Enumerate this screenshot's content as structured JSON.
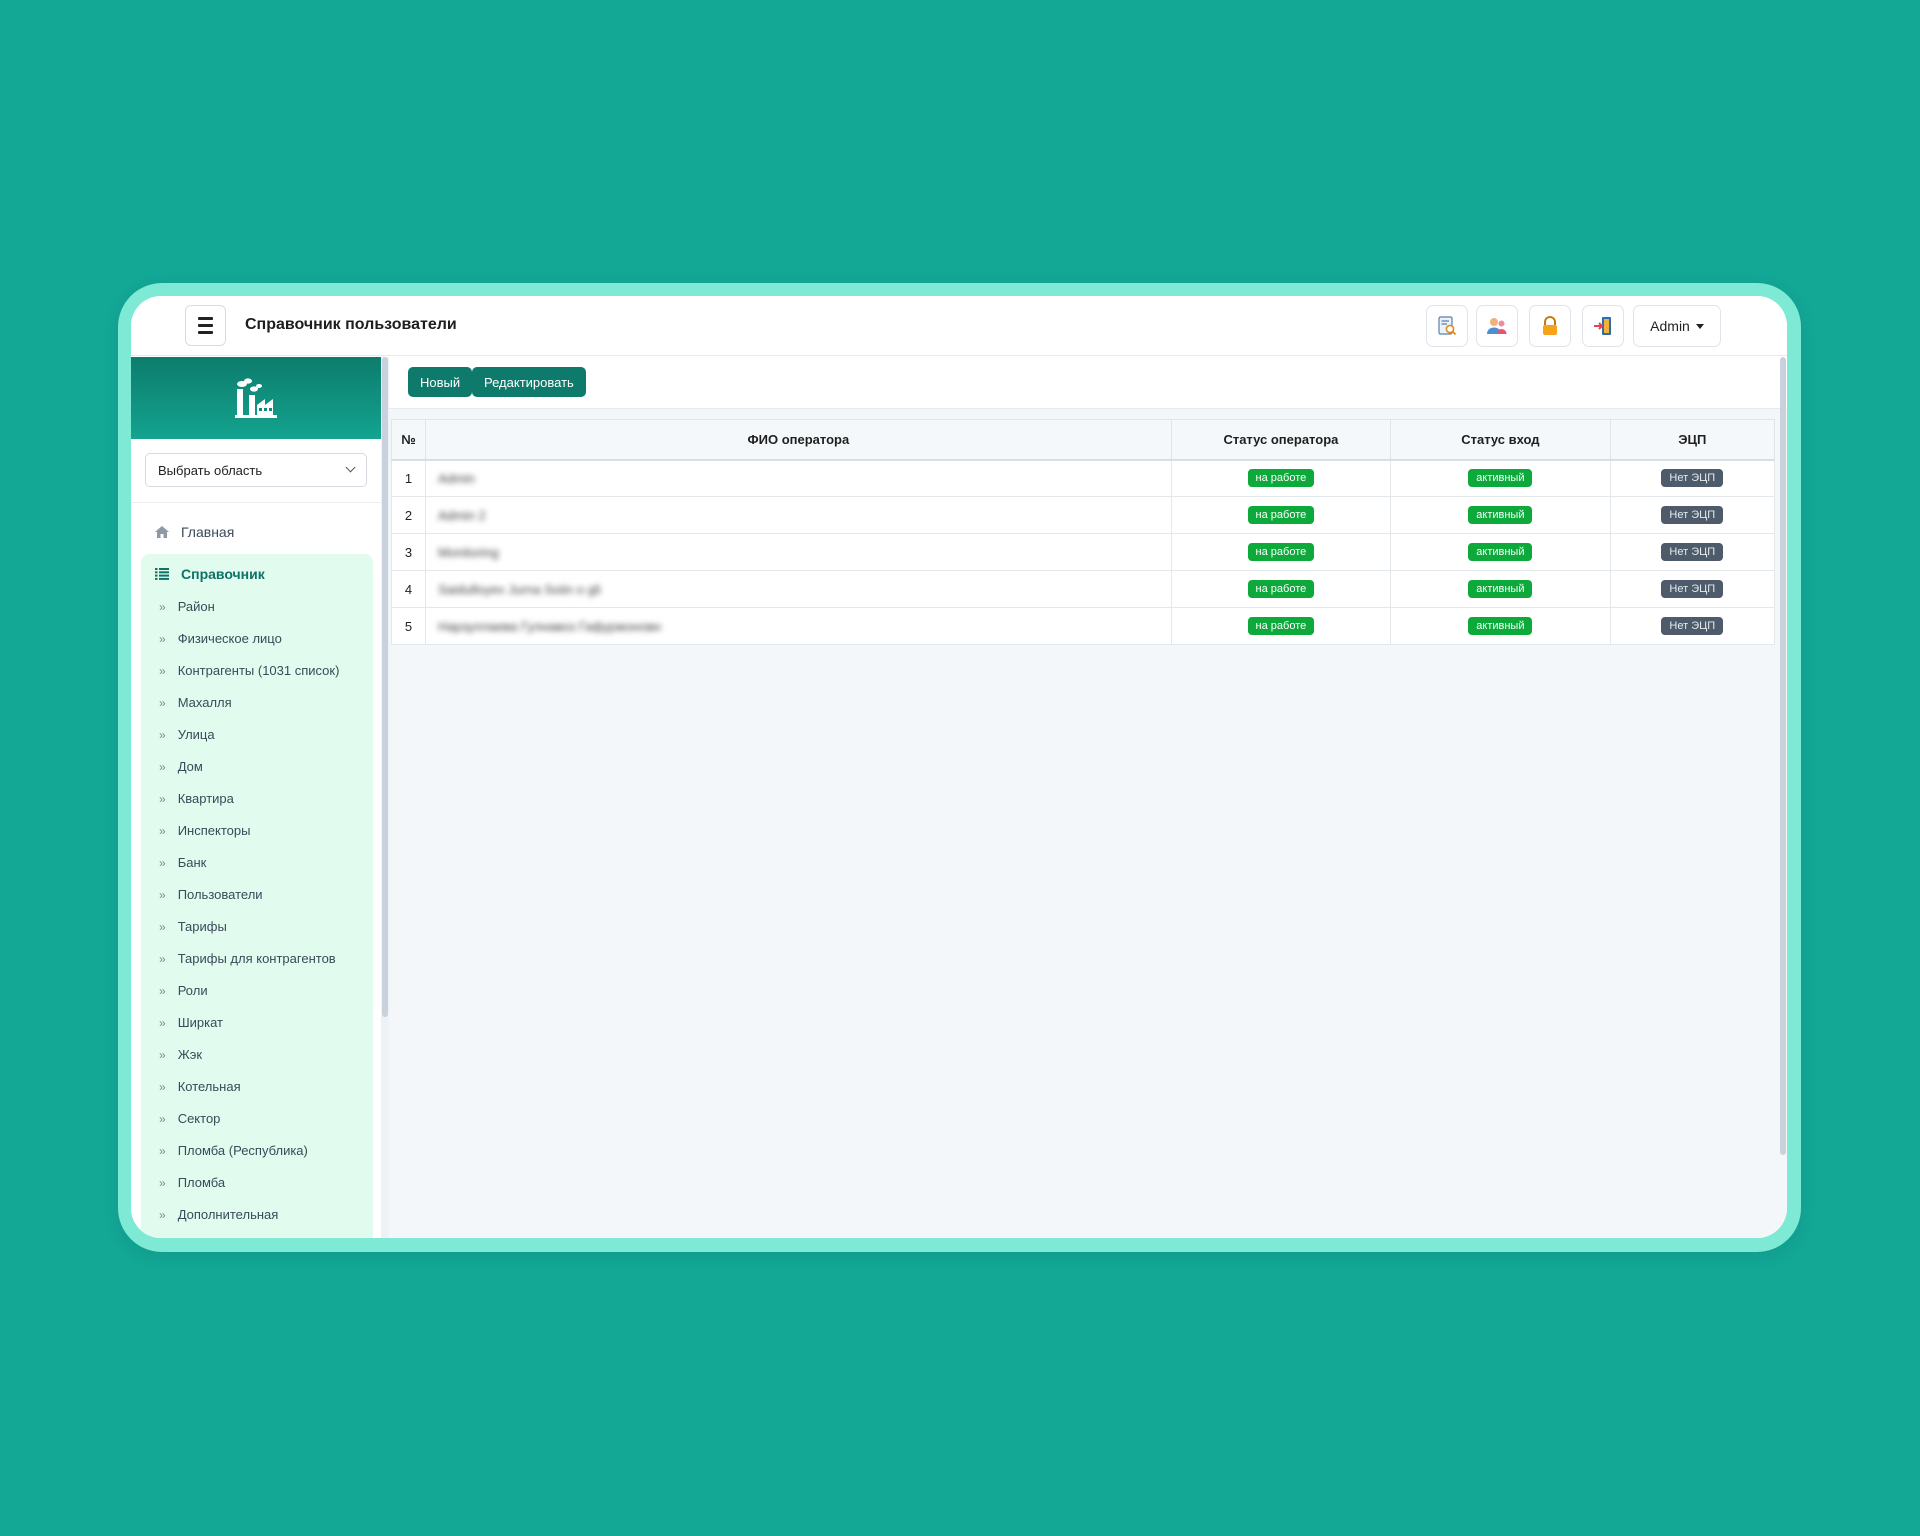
{
  "topbar": {
    "menu_icon": "hamburger-icon",
    "title": "Справочник пользователи",
    "icons": [
      "report-search-icon",
      "users-icon",
      "lock-icon",
      "logout-icon"
    ],
    "user_label": "Admin"
  },
  "sidebar": {
    "logo_icon": "factory-icon",
    "region_select": "Выбрать область",
    "home_label": "Главная",
    "group_label": "Справочник",
    "items": [
      "Район",
      "Физическое лицо",
      "Контрагенты (1031 список)",
      "Махалля",
      "Улица",
      "Дом",
      "Квартира",
      "Инспекторы",
      "Банк",
      "Пользователи",
      "Тарифы",
      "Тарифы для контрагентов",
      "Роли",
      "Ширкат",
      "Жэк",
      "Котельная",
      "Сектор",
      "Пломба (Республика)",
      "Пломба",
      "Дополнительная"
    ]
  },
  "toolbar": {
    "new_label": "Новый",
    "edit_label": "Редактировать"
  },
  "table": {
    "headers": [
      "№",
      "ФИО оператора",
      "Статус оператора",
      "Статус вход",
      "ЭЦП"
    ],
    "rows": [
      {
        "num": "1",
        "name": "Admin",
        "status": "на работе",
        "login": "активный",
        "eds": "Нет ЭЦП"
      },
      {
        "num": "2",
        "name": "Admin 2",
        "status": "на работе",
        "login": "активный",
        "eds": "Нет ЭЦП"
      },
      {
        "num": "3",
        "name": "Monitoring",
        "status": "на работе",
        "login": "активный",
        "eds": "Нет ЭЦП"
      },
      {
        "num": "4",
        "name": "Saidulloyev Jurna Soiin o gli",
        "status": "на работе",
        "login": "активный",
        "eds": "Нет ЭЦП"
      },
      {
        "num": "5",
        "name": "Нарзуллаева Гулнавоз Гафуржоновн",
        "status": "на работе",
        "login": "активный",
        "eds": "Нет ЭЦП"
      }
    ]
  },
  "colors": {
    "background": "#13a796",
    "primary": "#0e7a6b",
    "badge_green": "#0ea93b",
    "badge_gray": "#4d5b6b"
  }
}
